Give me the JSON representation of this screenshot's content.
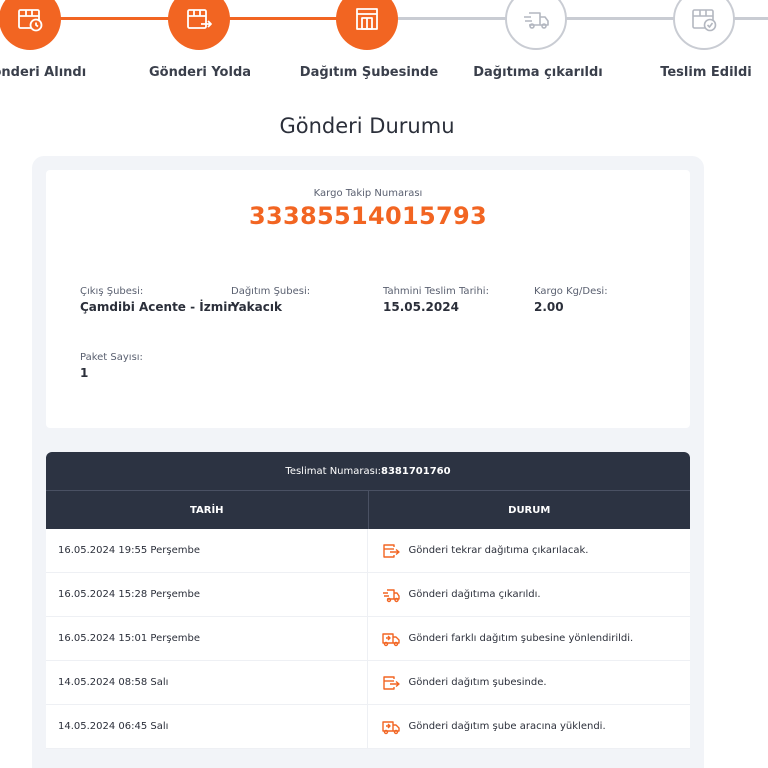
{
  "colors": {
    "accent": "#f26522",
    "header_dark": "#2c3342",
    "inactive": "#c9ccd3"
  },
  "stepper": {
    "steps": [
      {
        "label": "Gönderi Alındı",
        "icon": "package-clock-icon",
        "state": "done"
      },
      {
        "label": "Gönderi Yolda",
        "icon": "package-moving-icon",
        "state": "done"
      },
      {
        "label": "Dağıtım Şubesinde",
        "icon": "branch-building-icon",
        "state": "done"
      },
      {
        "label": "Dağıtıma çıkarıldı",
        "icon": "delivery-truck-icon",
        "state": "pending"
      },
      {
        "label": "Teslim Edildi",
        "icon": "package-check-icon",
        "state": "pending"
      }
    ]
  },
  "page": {
    "title": "Gönderi Durumu"
  },
  "shipment": {
    "tracking_label": "Kargo Takip Numarası",
    "tracking_number": "33385514015793",
    "origin_label": "Çıkış Şubesi:",
    "origin_value": "Çamdibi Acente - İzmir",
    "dest_label": "Dağıtım Şubesi:",
    "dest_value": "Yakacık",
    "eta_label": "Tahmini Teslim Tarihi:",
    "eta_value": "15.05.2024",
    "weight_label": "Kargo Kg/Desi:",
    "weight_value": "2.00",
    "packages_label": "Paket Sayısı:",
    "packages_value": "1"
  },
  "table": {
    "delivery_label": "Teslimat Numarası:",
    "delivery_number": "8381701760",
    "col_date": "TARİH",
    "col_status": "DURUM",
    "rows": [
      {
        "date": "16.05.2024 19:55 Perşembe",
        "status": "Gönderi tekrar dağıtıma çıkarılacak.",
        "icon": "redirect-box-icon"
      },
      {
        "date": "16.05.2024 15:28 Perşembe",
        "status": "Gönderi dağıtıma çıkarıldı.",
        "icon": "fast-truck-icon"
      },
      {
        "date": "16.05.2024 15:01 Perşembe",
        "status": "Gönderi farklı dağıtım şubesine yönlendirildi.",
        "icon": "truck-icon"
      },
      {
        "date": "14.05.2024 08:58 Salı",
        "status": "Gönderi dağıtım şubesinde.",
        "icon": "redirect-box-icon"
      },
      {
        "date": "14.05.2024 06:45 Salı",
        "status": "Gönderi dağıtım şube aracına yüklendi.",
        "icon": "truck-icon"
      }
    ]
  }
}
